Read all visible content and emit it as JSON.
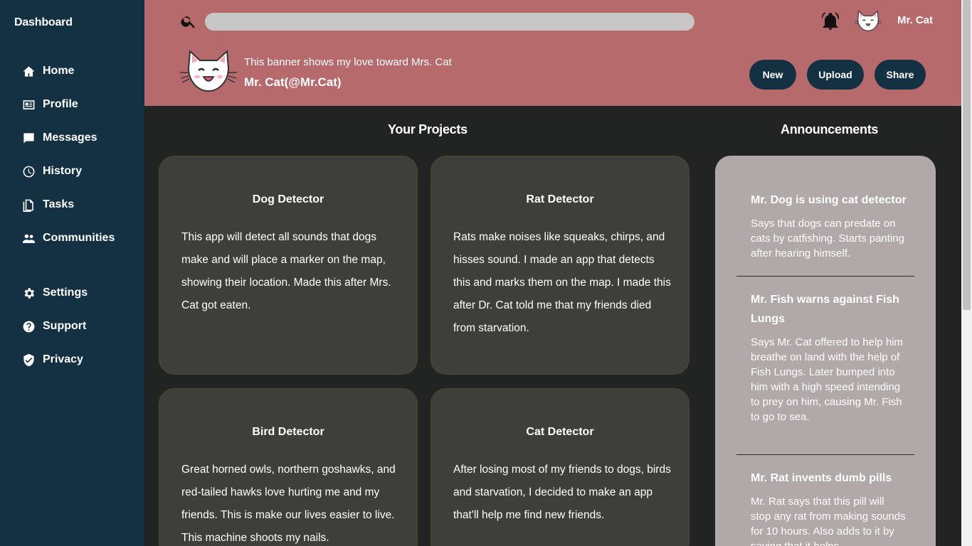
{
  "sidebar": {
    "title": "Dashboard",
    "items": [
      {
        "label": "Home",
        "icon": "home-icon"
      },
      {
        "label": "Profile",
        "icon": "profile-card-icon"
      },
      {
        "label": "Messages",
        "icon": "message-icon"
      },
      {
        "label": "History",
        "icon": "clock-icon"
      },
      {
        "label": "Tasks",
        "icon": "document-icon"
      },
      {
        "label": "Communities",
        "icon": "group-icon"
      },
      {
        "label": "Settings",
        "icon": "gear-icon"
      },
      {
        "label": "Support",
        "icon": "help-icon"
      },
      {
        "label": "Privacy",
        "icon": "shield-icon"
      }
    ]
  },
  "header": {
    "search_placeholder": "",
    "username": "Mr. Cat",
    "banner_text": "This banner shows my love toward Mrs. Cat",
    "banner_handle": "Mr. Cat(@Mr.Cat)",
    "buttons": {
      "new": "New",
      "upload": "Upload",
      "share": "Share"
    }
  },
  "projects": {
    "title": "Your Projects",
    "cards": [
      {
        "title": "Dog Detector",
        "desc": "This app will detect all sounds that dogs make and will place a marker on the map, showing their location. Made this after Mrs. Cat got eaten."
      },
      {
        "title": "Rat Detector",
        "desc": "Rats make noises like squeaks, chirps, and hisses sound. I made an app that detects this and marks them on the map. I made this after Dr. Cat told me that my friends died from starvation."
      },
      {
        "title": "Bird Detector",
        "desc": "Great horned owls, northern goshawks, and red-tailed hawks love hurting me and my friends. This is make our lives easier to live. This machine shoots my nails."
      },
      {
        "title": "Cat Detector",
        "desc": "After losing most of my friends to dogs, birds and starvation, I decided to make an app that'll help me find new friends."
      }
    ]
  },
  "announcements": {
    "title": "Announcements",
    "items": [
      {
        "title": "Mr. Dog is using cat detector",
        "text": "Says that dogs can predate on cats by catfishing. Starts panting after hearing himself."
      },
      {
        "title": "Mr. Fish warns against Fish Lungs",
        "text": "Says Mr. Cat offered to help him breathe on land with the help of Fish Lungs. Later bumped into him with a high speed intending to prey on him, causing Mr. Fish to go to sea."
      },
      {
        "title": "Mr. Rat invents dumb pills",
        "text": "Mr. Rat says that this pill will stop any rat from making sounds for 10 hours. Also adds to it by saying that it helps"
      }
    ]
  },
  "colors": {
    "sidebar_bg": "#143144",
    "header_bg": "#b76a6c",
    "main_bg": "#222423",
    "card_bg": "#3e3f3a",
    "announce_bg": "#b0a8a9",
    "button_bg": "#143144"
  }
}
